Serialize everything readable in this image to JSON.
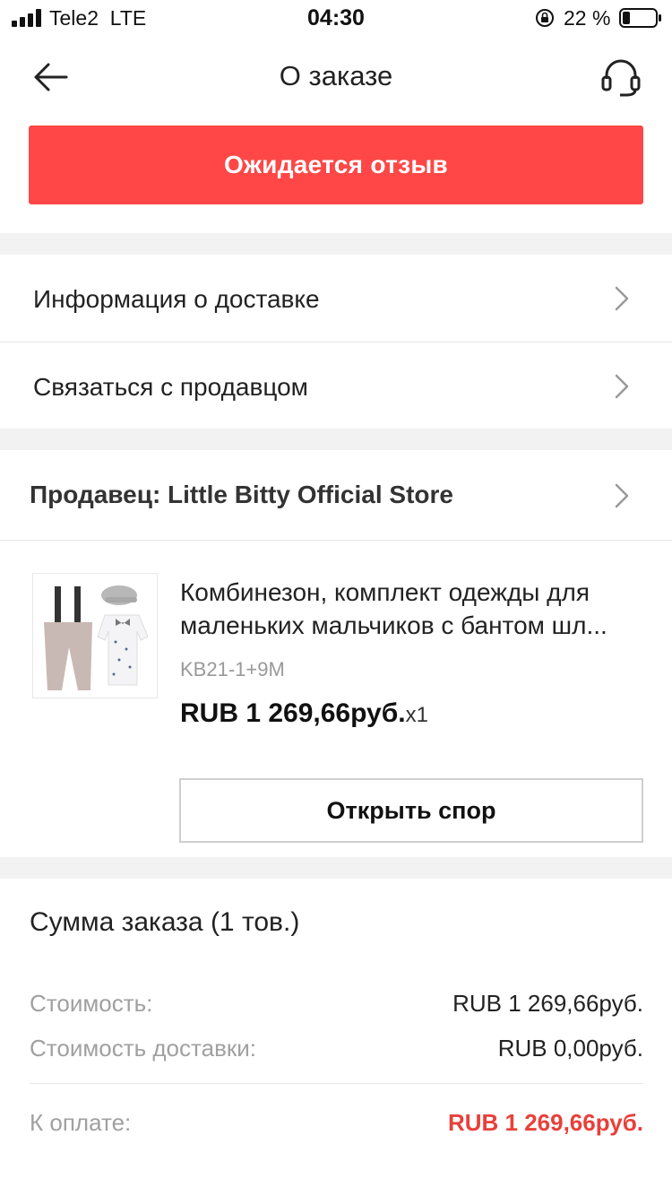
{
  "status_bar": {
    "carrier": "Tele2",
    "network": "LTE",
    "time": "04:30",
    "battery": "22 %"
  },
  "nav": {
    "title": "О заказе",
    "back_icon": "arrow-left-icon",
    "support_icon": "headset-icon"
  },
  "order_status": {
    "label": "Ожидается отзыв",
    "color": "#ff4747"
  },
  "menu": {
    "delivery_info": "Информация о доставке",
    "contact_seller": "Связаться с продавцом"
  },
  "seller": {
    "label": "Продавец: Little Bitty Official Store"
  },
  "product": {
    "title": "Комбинезон, комплект одежды для маленьких мальчиков с бантом шл...",
    "sku": "KB21-1+9M",
    "price": "RUB 1 269,66руб.",
    "quantity": "x1"
  },
  "dispute": {
    "label": "Открыть спор"
  },
  "summary": {
    "title": "Сумма заказа (1 тов.)",
    "cost_label": "Стоимость:",
    "cost_value": "RUB 1 269,66руб.",
    "shipping_label": "Стоимость доставки:",
    "shipping_value": "RUB 0,00руб.",
    "total_label": "К оплате:",
    "total_value": "RUB 1 269,66руб.",
    "total_color": "#e8403a"
  }
}
